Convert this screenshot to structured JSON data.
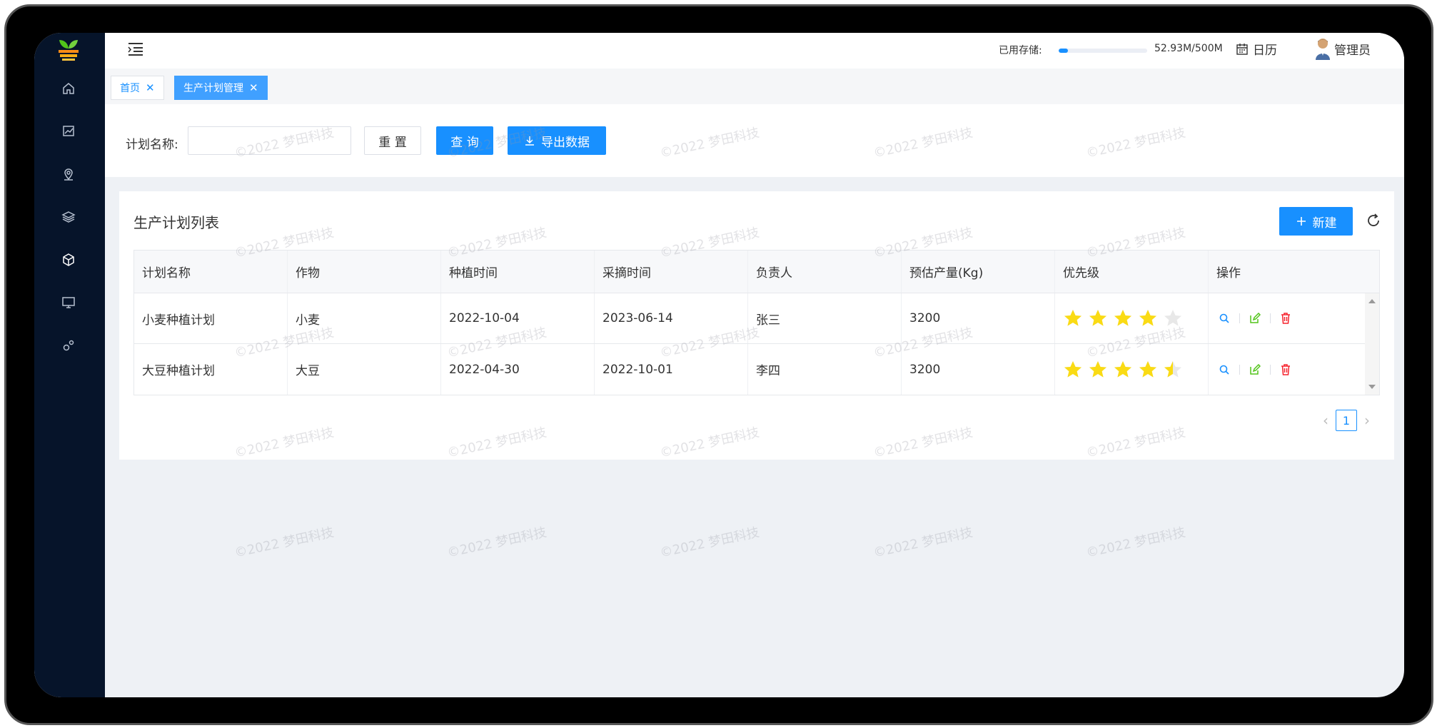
{
  "topbar": {
    "storage_label": "已用存储:",
    "storage_used_fraction": 0.106,
    "storage_text": "52.93M/500M",
    "calendar_label": "日历",
    "user_name": "管理员"
  },
  "tabs": [
    {
      "label": "首页",
      "active": false
    },
    {
      "label": "生产计划管理",
      "active": true
    }
  ],
  "search": {
    "label": "计划名称:",
    "value": "",
    "reset_label": "重 置",
    "query_label": "查 询",
    "export_label": "导出数据"
  },
  "list": {
    "title": "生产计划列表",
    "new_label": "新建",
    "columns": [
      "计划名称",
      "作物",
      "种植时间",
      "采摘时间",
      "负责人",
      "预估产量(Kg)",
      "优先级",
      "操作"
    ],
    "rows": [
      {
        "name": "小麦种植计划",
        "crop": "小麦",
        "plant_date": "2022-10-04",
        "harvest_date": "2023-06-14",
        "owner": "张三",
        "yield": "3200",
        "priority": 4
      },
      {
        "name": "大豆种植计划",
        "crop": "大豆",
        "plant_date": "2022-04-30",
        "harvest_date": "2022-10-01",
        "owner": "李四",
        "yield": "3200",
        "priority": 4.5
      }
    ]
  },
  "pager": {
    "current": "1"
  },
  "watermark": "©2022 梦田科技",
  "colors": {
    "primary": "#1890ff",
    "sidebar": "#06142a",
    "star": "#fadb14",
    "star_empty": "#e8e8e8",
    "edit": "#52c41a",
    "delete": "#f5222d"
  }
}
